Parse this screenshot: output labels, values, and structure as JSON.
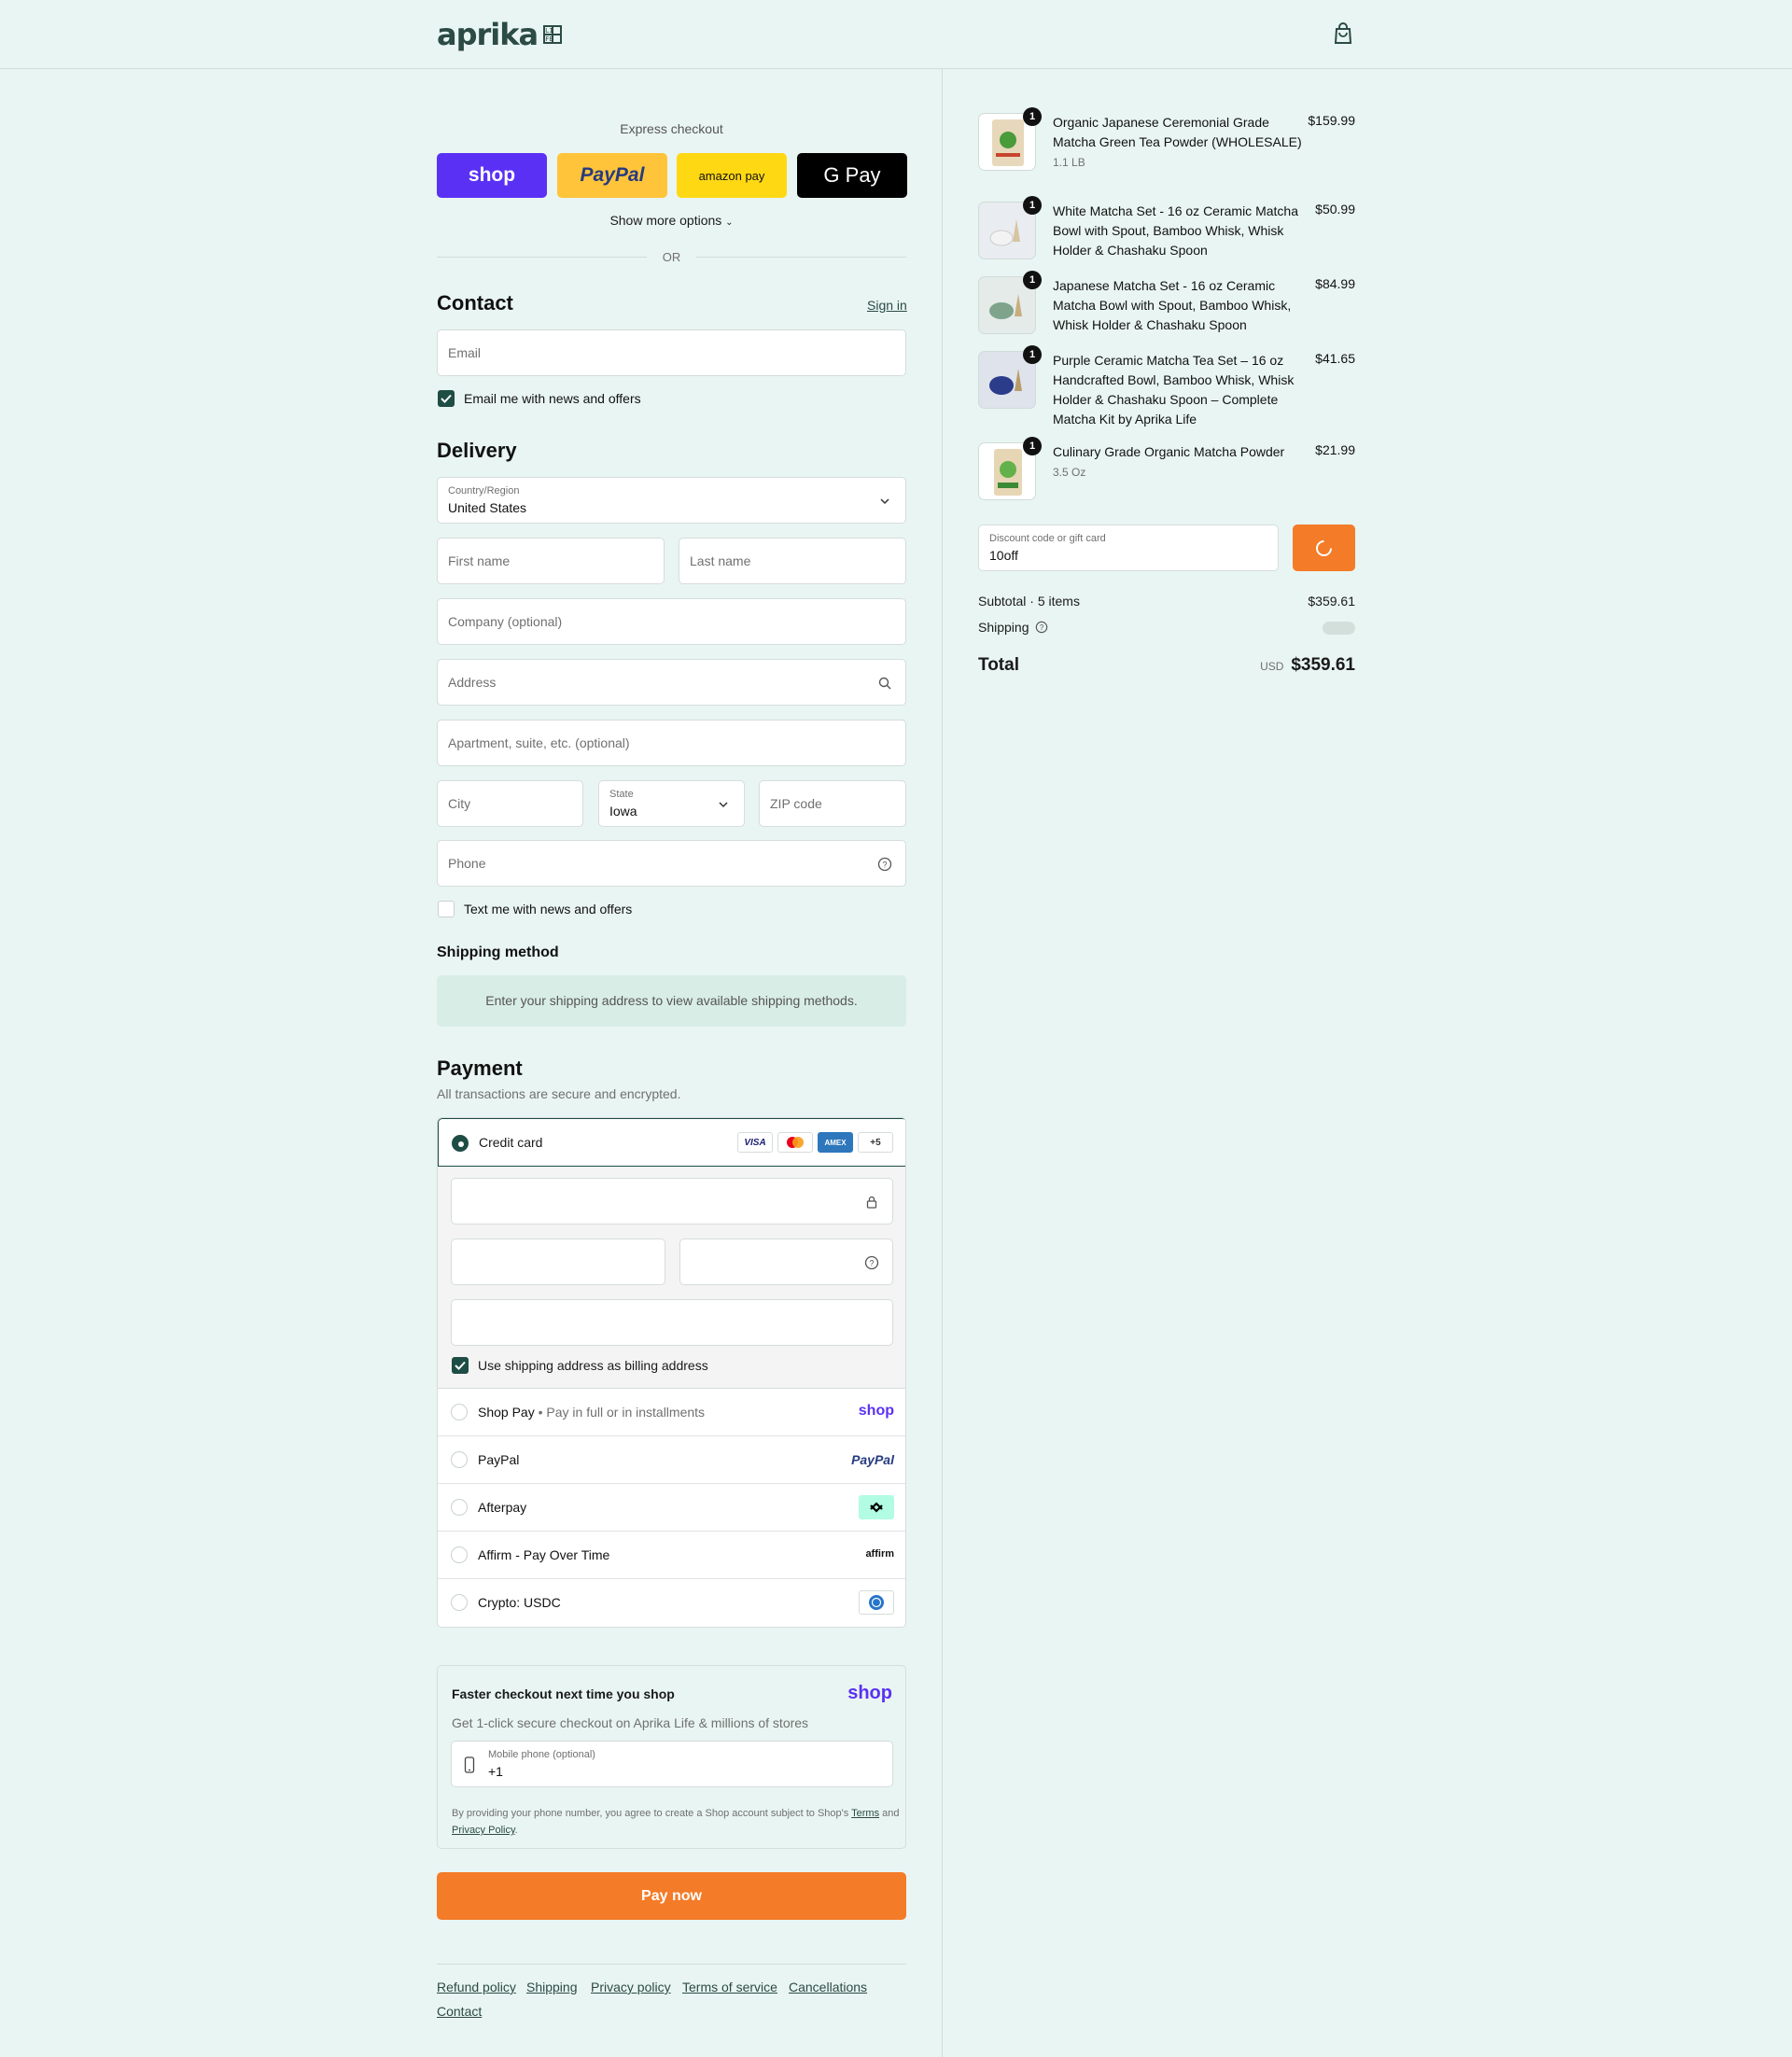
{
  "brand": {
    "name": "aprika",
    "badge": [
      "LI",
      "FE"
    ]
  },
  "express": {
    "title": "Express checkout",
    "buttons": [
      {
        "label": "shop",
        "bg": "#5a31f4"
      },
      {
        "label": "PayPal",
        "bg": "#ffc439"
      },
      {
        "label": "amazon pay",
        "bg": "#ffd814"
      },
      {
        "label": "G Pay",
        "bg": "#000000"
      }
    ],
    "more": "Show more options",
    "or": "OR"
  },
  "contact": {
    "title": "Contact",
    "signin": "Sign in",
    "email_placeholder": "Email",
    "news_label": "Email me with news and offers"
  },
  "delivery": {
    "title": "Delivery",
    "country_label": "Country/Region",
    "country_value": "United States",
    "first_name": "First name",
    "last_name": "Last name",
    "company": "Company (optional)",
    "address": "Address",
    "apartment": "Apartment, suite, etc. (optional)",
    "city": "City",
    "state_label": "State",
    "state_value": "Iowa",
    "zip": "ZIP code",
    "phone": "Phone",
    "text_label": "Text me with news and offers"
  },
  "shipping": {
    "title": "Shipping method",
    "info": "Enter your shipping address to view available shipping methods."
  },
  "payment": {
    "title": "Payment",
    "subtitle": "All transactions are secure and encrypted.",
    "credit_card": "Credit card",
    "cards": [
      "VISA",
      "MC",
      "AMEX",
      "+5"
    ],
    "billing_label": "Use shipping address as billing address",
    "methods": [
      {
        "name": "Shop Pay",
        "sub": "Pay in full or in installments",
        "logo": "shop"
      },
      {
        "name": "PayPal",
        "sub": "",
        "logo": "PayPal"
      },
      {
        "name": "Afterpay",
        "sub": "",
        "logo": "afterpay-icon"
      },
      {
        "name": "Affirm - Pay Over Time",
        "sub": "",
        "logo": "affirm"
      },
      {
        "name": "Crypto: USDC",
        "sub": "",
        "logo": "usdc-icon"
      }
    ]
  },
  "faster": {
    "title": "Faster checkout next time you shop",
    "logo": "shop",
    "subtitle": "Get 1-click secure checkout on Aprika Life & millions of stores",
    "phone_label": "Mobile phone (optional)",
    "phone_value": "+1",
    "legal_prefix": "By providing your phone number, you agree to create a Shop account subject to Shop's",
    "terms": "Terms",
    "and": "and",
    "privacy": "Privacy Policy",
    "period": "."
  },
  "pay_now": "Pay now",
  "footer": [
    "Refund policy",
    "Shipping",
    "Privacy policy",
    "Terms of service",
    "Cancellations",
    "Contact"
  ],
  "cart": {
    "items": [
      {
        "qty": "1",
        "name": "Organic Japanese Ceremonial Grade Matcha Green Tea Powder (WHOLESALE)",
        "sub": "1.1 LB",
        "price": "$159.99"
      },
      {
        "qty": "1",
        "name": "White Matcha Set - 16 oz Ceramic Matcha Bowl with Spout, Bamboo Whisk, Whisk Holder & Chashaku Spoon",
        "sub": "",
        "price": "$50.99"
      },
      {
        "qty": "1",
        "name": "Japanese Matcha Set - 16 oz Ceramic Matcha Bowl with Spout, Bamboo Whisk, Whisk Holder & Chashaku Spoon",
        "sub": "",
        "price": "$84.99"
      },
      {
        "qty": "1",
        "name": "Purple Ceramic Matcha Tea Set – 16 oz Handcrafted Bowl, Bamboo Whisk, Whisk Holder & Chashaku Spoon – Complete Matcha Kit by Aprika Life",
        "sub": "",
        "price": "$41.65"
      },
      {
        "qty": "1",
        "name": "Culinary Grade Organic Matcha Powder",
        "sub": "3.5 Oz",
        "price": "$21.99"
      }
    ],
    "discount_label": "Discount code or gift card",
    "discount_value": "10off",
    "subtotal_label": "Subtotal · 5 items",
    "subtotal_value": "$359.61",
    "shipping_label": "Shipping",
    "total_label": "Total",
    "currency": "USD",
    "total_value": "$359.61"
  },
  "colors": {
    "accent": "#f47b27",
    "brand": "#1e4d45",
    "background": "#e9f5f2"
  }
}
